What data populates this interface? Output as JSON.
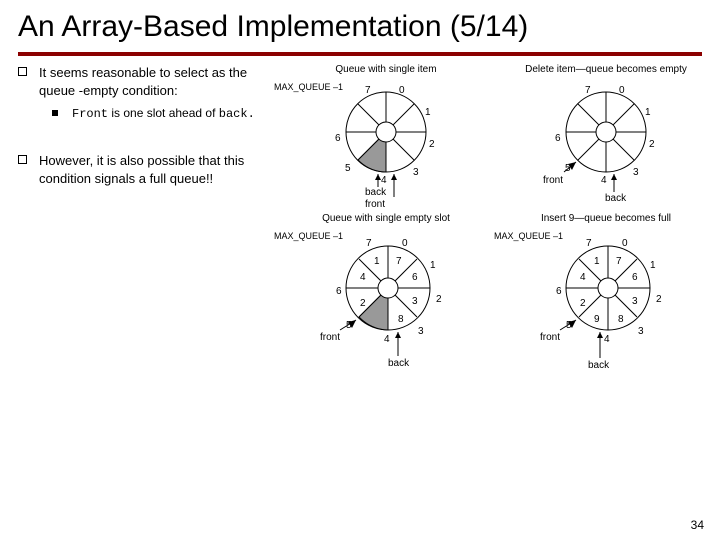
{
  "title": "An Array-Based Implementation (5/14)",
  "bullets": {
    "b1": "It seems reasonable to select as the queue -empty condition:",
    "sub1_pre": "Front",
    "sub1_mid": " is one slot ahead of ",
    "sub1_post": "back.",
    "b2": "However, it is also possible that this condition signals a full queue!!"
  },
  "top_charts": {
    "left_title": "Queue with single item",
    "right_title": "Delete item—queue becomes empty",
    "mq_label": "MAX_QUEUE –1",
    "outer": [
      "7",
      "0",
      "1",
      "2",
      "3",
      "4",
      "5",
      "6"
    ],
    "left_labels": {
      "back": "back",
      "front": "front"
    },
    "right_labels": {
      "front": "front",
      "back": "back"
    }
  },
  "bot_charts": {
    "left_title": "Queue with single empty slot",
    "right_title": "Insert 9—queue becomes full",
    "mq_label": "MAX_QUEUE –1",
    "outer": [
      "7",
      "0",
      "1",
      "2",
      "3",
      "4",
      "5",
      "6"
    ],
    "inner": [
      "1",
      "7",
      "6",
      "3",
      "8",
      "",
      "2",
      "4"
    ],
    "inner_right": [
      "1",
      "7",
      "6",
      "3",
      "8",
      "9",
      "2",
      "4"
    ],
    "left_labels": {
      "front": "front",
      "back": "back"
    },
    "right_labels": {
      "front": "front",
      "back": "back"
    }
  },
  "page": "34"
}
